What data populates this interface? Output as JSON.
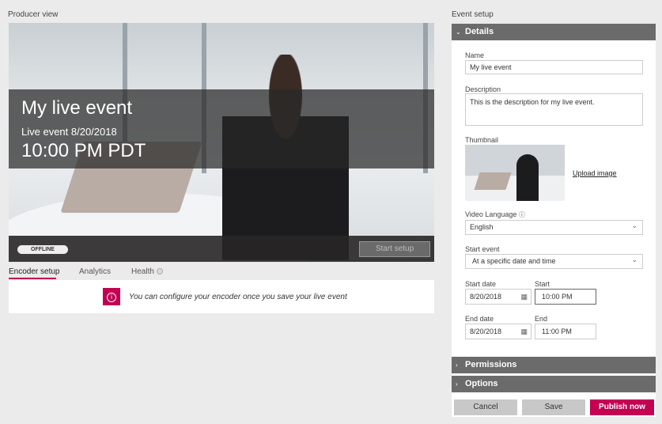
{
  "producer": {
    "title": "Producer view",
    "event_title": "My live event",
    "event_date": "Live event 8/20/2018",
    "event_time": "10:00 PM PDT",
    "status": "OFFLINE",
    "start_setup": "Start setup"
  },
  "tabs": [
    {
      "label": "Encoder setup",
      "active": true
    },
    {
      "label": "Analytics"
    },
    {
      "label": "Health"
    }
  ],
  "message": {
    "icon": "info-icon",
    "text": "You can configure your encoder once you save your live event"
  },
  "setup": {
    "title": "Event setup",
    "details": {
      "header": "Details",
      "name_label": "Name",
      "name_value": "My live event",
      "desc_label": "Description",
      "desc_value": "This is the description for my live event.",
      "thumb_label": "Thumbnail",
      "upload": "Upload image",
      "lang_label": "Video Language",
      "lang_value": "English",
      "start_event_label": "Start event",
      "start_event_value": "At a specific date and time",
      "start_date_label": "Start date",
      "start_date": "8/20/2018",
      "start_label": "Start",
      "start_time": "10:00 PM",
      "end_date_label": "End date",
      "end_date": "8/20/2018",
      "end_label": "End",
      "end_time": "11:00 PM"
    },
    "permissions": "Permissions",
    "options": "Options"
  },
  "buttons": {
    "cancel": "Cancel",
    "save": "Save",
    "publish": "Publish now"
  },
  "colors": {
    "accent": "#c30052",
    "header": "#6b6b6b"
  }
}
